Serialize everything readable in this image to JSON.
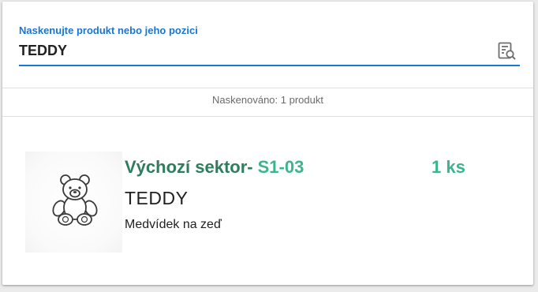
{
  "scan": {
    "label": "Naskenujte produkt nebo jeho pozici",
    "value": "TEDDY",
    "icon": "document-search-icon"
  },
  "status": {
    "text": "Naskenováno: 1 produkt"
  },
  "product": {
    "sector_label": "Výchozí sektor-",
    "sector_code": "S1-03",
    "quantity": "1 ks",
    "name": "TEDDY",
    "description": "Medvídek na zeď",
    "image": "teddy-bear-image"
  },
  "colors": {
    "accent": "#1976d2",
    "sector_label": "#2e7d5b",
    "sector_code": "#3bb58a",
    "quantity": "#3bb58a"
  }
}
